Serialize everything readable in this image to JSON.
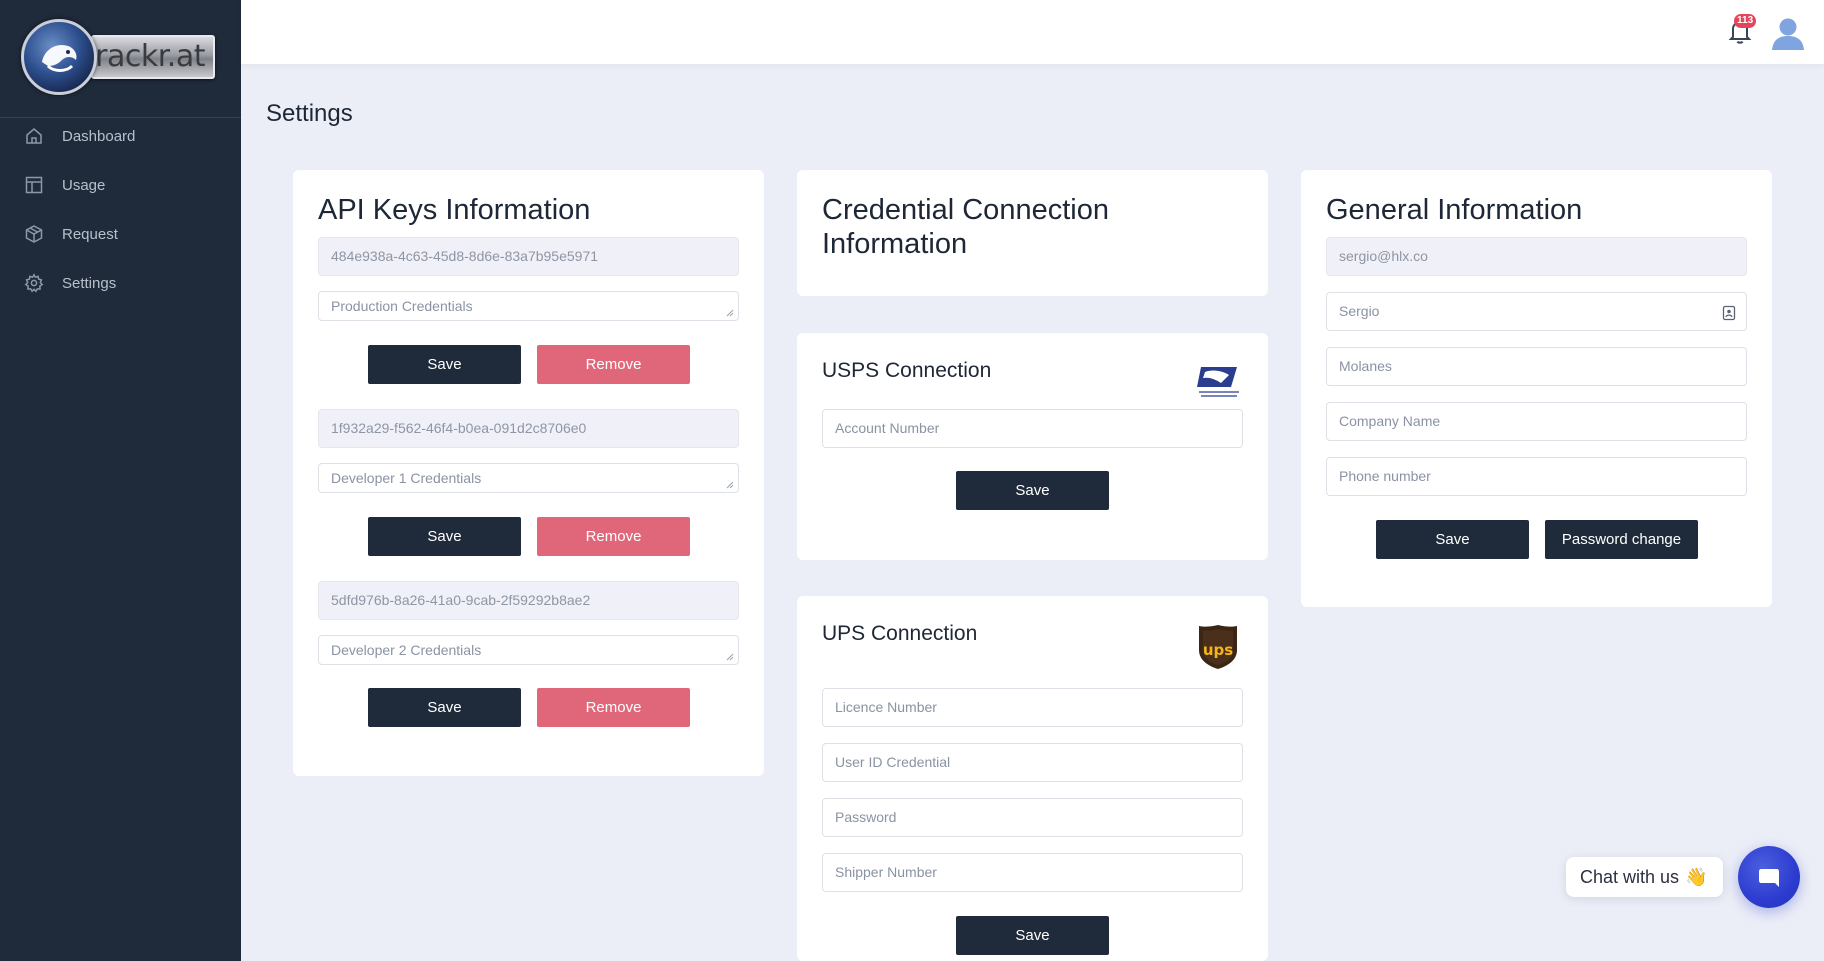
{
  "brand": {
    "logo_text": "trackr.at"
  },
  "sidebar": {
    "items": [
      {
        "label": "Dashboard",
        "icon": "home-icon"
      },
      {
        "label": "Usage",
        "icon": "layout-icon"
      },
      {
        "label": "Request",
        "icon": "box-icon"
      },
      {
        "label": "Settings",
        "icon": "gear-icon"
      }
    ]
  },
  "header": {
    "notification_count": "113"
  },
  "page": {
    "title": "Settings"
  },
  "api_keys": {
    "title": "API Keys Information",
    "keys": [
      {
        "key": "484e938a-4c63-45d8-8d6e-83a7b95e5971",
        "name_placeholder": "Production Credentials",
        "save": "Save",
        "remove": "Remove"
      },
      {
        "key": "1f932a29-f562-46f4-b0ea-091d2c8706e0",
        "name_placeholder": "Developer 1 Credentials",
        "save": "Save",
        "remove": "Remove"
      },
      {
        "key": "5dfd976b-8a26-41a0-9cab-2f59292b8ae2",
        "name_placeholder": "Developer 2 Credentials",
        "save": "Save",
        "remove": "Remove"
      }
    ]
  },
  "credentials": {
    "title": "Credential Connection Information",
    "usps": {
      "title": "USPS Connection",
      "account_placeholder": "Account Number",
      "save": "Save"
    },
    "ups": {
      "title": "UPS Connection",
      "licence_placeholder": "Licence Number",
      "user_id_placeholder": "User ID Credential",
      "password_placeholder": "Password",
      "shipper_placeholder": "Shipper Number",
      "save": "Save"
    }
  },
  "general": {
    "title": "General Information",
    "email": "sergio@hlx.co",
    "first_name": "Sergio",
    "last_name": "Molanes",
    "company_placeholder": "Company Name",
    "phone_placeholder": "Phone number",
    "save": "Save",
    "password_change": "Password change"
  },
  "chat": {
    "label": "Chat with us",
    "emoji": "👋"
  },
  "colors": {
    "sidebar": "#1f2a3a",
    "background": "#eceef7",
    "primary_button": "#1f2a3a",
    "danger_button": "#e0677a",
    "badge": "#e5445a",
    "chat_accent": "#2d3ccf"
  }
}
